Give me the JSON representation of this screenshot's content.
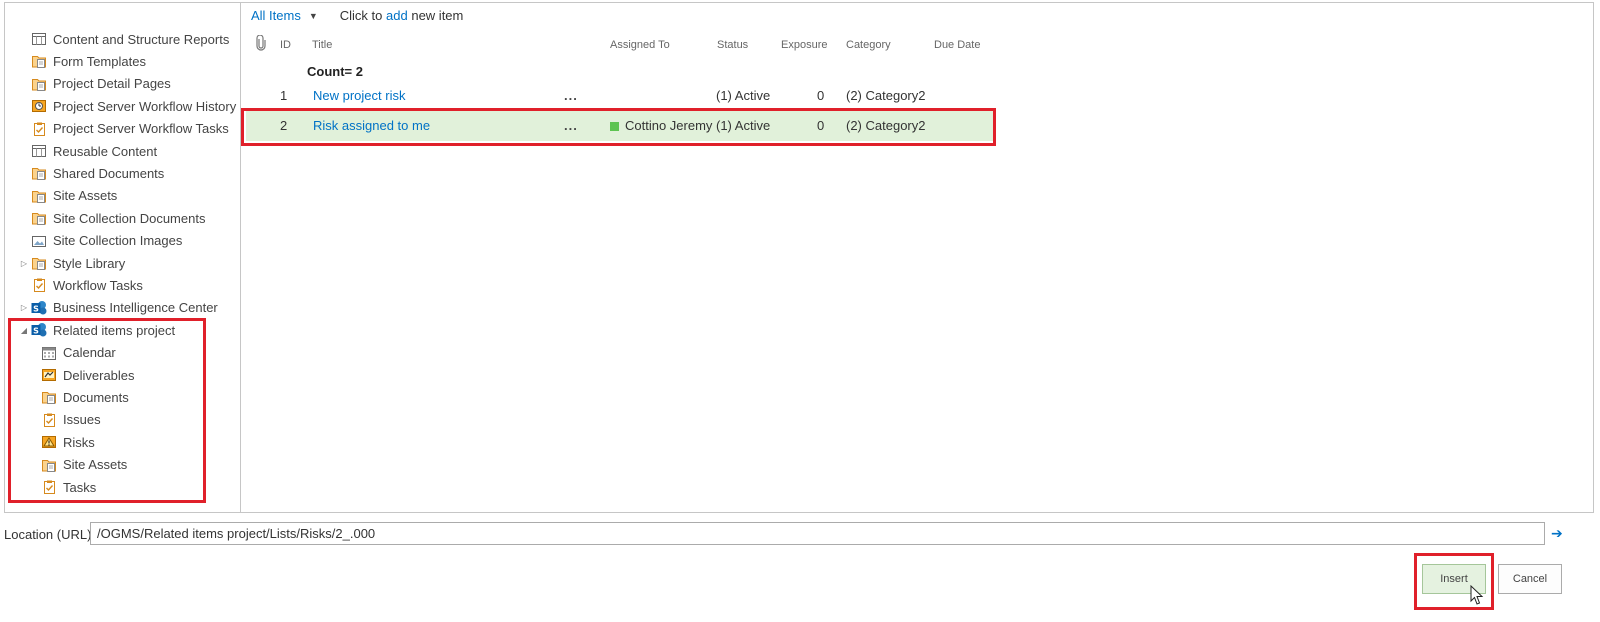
{
  "tree": {
    "items": [
      {
        "label": "Content and Structure Reports",
        "icon": "list-icon",
        "level": 1,
        "expandable": false
      },
      {
        "label": "Form Templates",
        "icon": "library-icon",
        "level": 1,
        "expandable": false
      },
      {
        "label": "Project Detail Pages",
        "icon": "library-icon",
        "level": 1,
        "expandable": false
      },
      {
        "label": "Project Server Workflow History",
        "icon": "workflow-history-icon",
        "level": 1,
        "expandable": false
      },
      {
        "label": "Project Server Workflow Tasks",
        "icon": "tasks-icon",
        "level": 1,
        "expandable": false
      },
      {
        "label": "Reusable Content",
        "icon": "list-icon",
        "level": 1,
        "expandable": false
      },
      {
        "label": "Shared Documents",
        "icon": "library-icon",
        "level": 1,
        "expandable": false
      },
      {
        "label": "Site Assets",
        "icon": "library-icon",
        "level": 1,
        "expandable": false
      },
      {
        "label": "Site Collection Documents",
        "icon": "library-icon",
        "level": 1,
        "expandable": false
      },
      {
        "label": "Site Collection Images",
        "icon": "picture-library-icon",
        "level": 1,
        "expandable": false
      },
      {
        "label": "Style Library",
        "icon": "library-icon",
        "level": 1,
        "expandable": true,
        "expanded": false
      },
      {
        "label": "Workflow Tasks",
        "icon": "tasks-icon",
        "level": 1,
        "expandable": false
      },
      {
        "label": "Business Intelligence Center",
        "icon": "sharepoint-site-icon",
        "level": 1,
        "expandable": true,
        "expanded": false
      },
      {
        "label": "Related items project",
        "icon": "sharepoint-site-icon",
        "level": 1,
        "expandable": true,
        "expanded": true
      },
      {
        "label": "Calendar",
        "icon": "calendar-icon",
        "level": 2,
        "expandable": false
      },
      {
        "label": "Deliverables",
        "icon": "deliverables-icon",
        "level": 2,
        "expandable": false
      },
      {
        "label": "Documents",
        "icon": "library-icon",
        "level": 2,
        "expandable": false
      },
      {
        "label": "Issues",
        "icon": "tasks-icon",
        "level": 2,
        "expandable": false
      },
      {
        "label": "Risks",
        "icon": "risk-icon",
        "level": 2,
        "expandable": false
      },
      {
        "label": "Site Assets",
        "icon": "library-icon",
        "level": 2,
        "expandable": false
      },
      {
        "label": "Tasks",
        "icon": "tasks-icon",
        "level": 2,
        "expandable": false
      }
    ]
  },
  "list": {
    "view_name": "All Items",
    "add_prefix": "Click to",
    "add_link": "add",
    "add_suffix": "new item",
    "columns": {
      "attachment": "attachment-icon",
      "id": "ID",
      "title": "Title",
      "assigned_to": "Assigned To",
      "status": "Status",
      "exposure": "Exposure",
      "category": "Category",
      "due_date": "Due Date"
    },
    "count_label": "Count= 2",
    "rows": [
      {
        "id": "1",
        "title": "New project risk",
        "menu": "...",
        "assigned_to": "",
        "status": "(1) Active",
        "exposure": "0",
        "category": "(2) Category2",
        "due_date": "",
        "selected": false
      },
      {
        "id": "2",
        "title": "Risk assigned to me",
        "menu": "...",
        "assigned_to": "Cottino Jeremy",
        "status": "(1) Active",
        "exposure": "0",
        "category": "(2) Category2",
        "due_date": "",
        "selected": true
      }
    ]
  },
  "location": {
    "label": "Location (URL):",
    "value": "/OGMS/Related items project/Lists/Risks/2_.000"
  },
  "buttons": {
    "insert": "Insert",
    "cancel": "Cancel"
  },
  "colors": {
    "accent": "#0072c6",
    "selected_row": "#e1f1da",
    "highlight_box": "#e0202a",
    "presence": "#5dc451"
  }
}
